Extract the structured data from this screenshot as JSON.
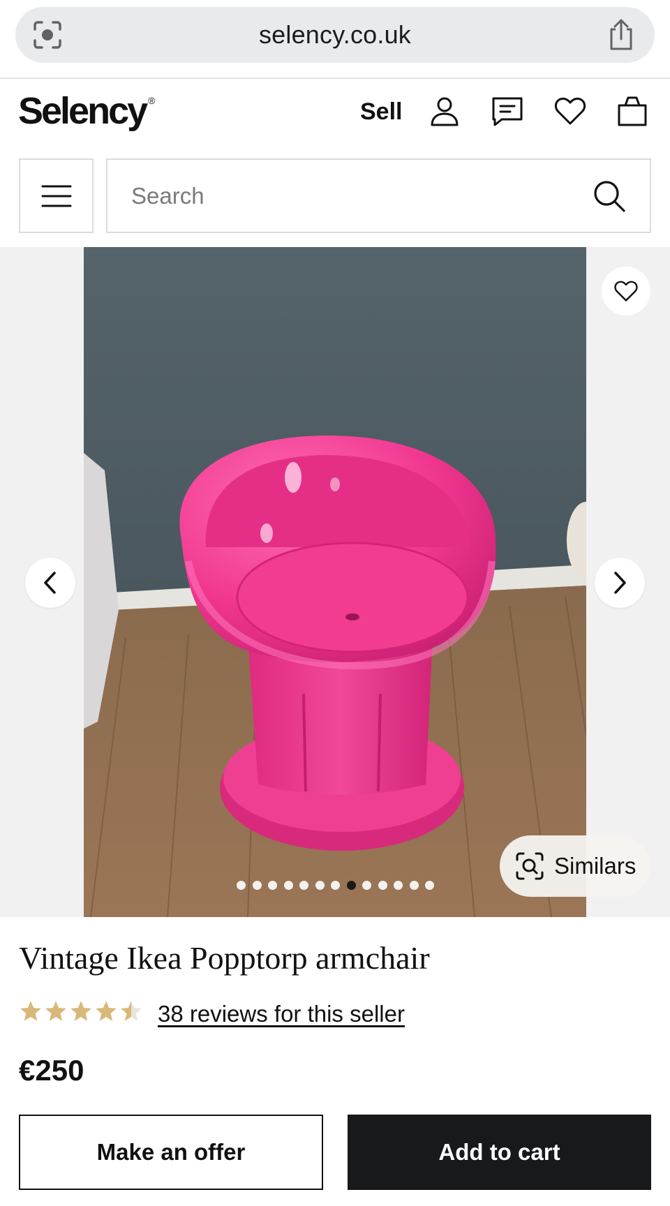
{
  "browser": {
    "url": "selency.co.uk"
  },
  "header": {
    "logo": "Selency",
    "logo_mark": "®",
    "sell_label": "Sell",
    "icons": [
      "account-icon",
      "messages-icon",
      "favorites-icon",
      "cart-icon"
    ]
  },
  "search": {
    "placeholder": "Search"
  },
  "gallery": {
    "similars_label": "Similars",
    "image_count": 13,
    "active_index": 7
  },
  "product": {
    "title": "Vintage Ikea Popptorp armchair",
    "rating": 4.5,
    "rating_max": 5,
    "reviews_link": "38 reviews for this seller",
    "price": "€250"
  },
  "actions": {
    "offer_label": "Make an offer",
    "cart_label": "Add to cart"
  },
  "colors": {
    "accent_dark": "#17191b",
    "star_gold": "#d8b878",
    "chair_pink": "#f0368f"
  }
}
